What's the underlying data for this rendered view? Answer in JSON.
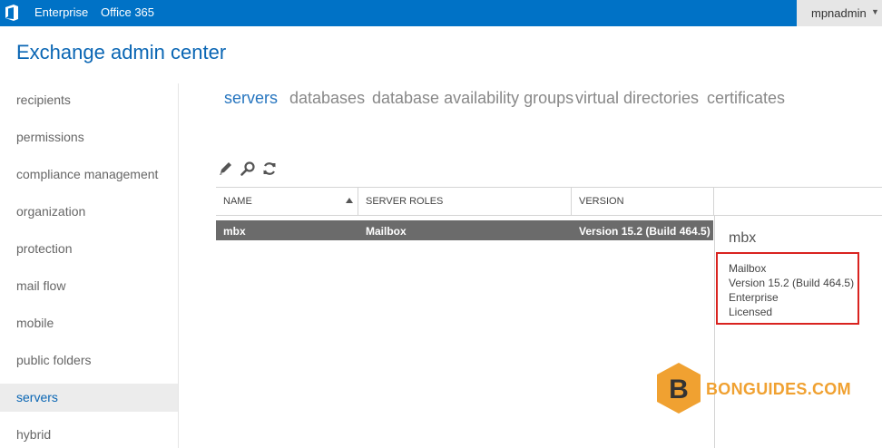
{
  "topbar": {
    "links": [
      "Enterprise",
      "Office 365"
    ],
    "user": "mpnadmin",
    "brand_color": "#0072c6"
  },
  "app_title": "Exchange admin center",
  "sidebar": {
    "items": [
      {
        "label": "recipients",
        "selected": false
      },
      {
        "label": "permissions",
        "selected": false
      },
      {
        "label": "compliance management",
        "selected": false
      },
      {
        "label": "organization",
        "selected": false
      },
      {
        "label": "protection",
        "selected": false
      },
      {
        "label": "mail flow",
        "selected": false
      },
      {
        "label": "mobile",
        "selected": false
      },
      {
        "label": "public folders",
        "selected": false
      },
      {
        "label": "servers",
        "selected": true
      },
      {
        "label": "hybrid",
        "selected": false
      }
    ]
  },
  "tabs": [
    {
      "label": "servers",
      "active": true
    },
    {
      "label": "databases",
      "active": false
    },
    {
      "label": "database availability groups",
      "active": false
    },
    {
      "label": "virtual directories",
      "active": false
    },
    {
      "label": "certificates",
      "active": false
    }
  ],
  "toolbar": {
    "icons": [
      "pencil-icon",
      "search-icon",
      "refresh-icon"
    ]
  },
  "table": {
    "columns": [
      "NAME",
      "SERVER ROLES",
      "VERSION"
    ],
    "sort_column": "NAME",
    "sort_direction": "ascending",
    "rows": [
      {
        "name": "mbx",
        "roles": "Mailbox",
        "version": "Version 15.2 (Build 464.5)",
        "selected": true
      }
    ]
  },
  "details": {
    "title": "mbx",
    "lines": [
      "Mailbox",
      "Version 15.2 (Build 464.5)",
      "Enterprise",
      "Licensed"
    ],
    "highlight_color": "#d9231f"
  },
  "watermark": {
    "badge_letter": "B",
    "text": "BONGUIDES.COM",
    "color": "#f0a131"
  }
}
